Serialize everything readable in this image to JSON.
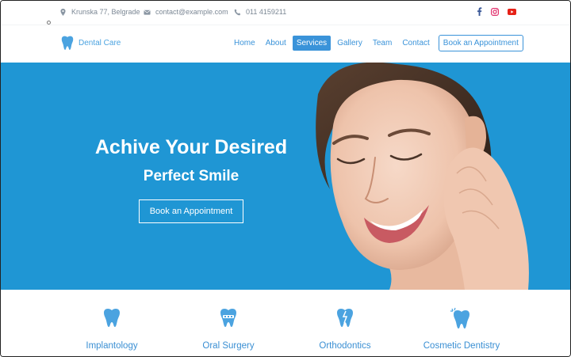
{
  "topbar": {
    "address": "Krunska 77, Belgrade",
    "email": "contact@example.com",
    "phone": "011 4159211",
    "social": [
      "facebook",
      "instagram",
      "youtube"
    ]
  },
  "header": {
    "brand": "Dental Care",
    "nav": [
      "Home",
      "About",
      "Services",
      "Gallery",
      "Team",
      "Contact"
    ],
    "active": "Services",
    "cta": "Book an Appointment"
  },
  "hero": {
    "title": "Achive Your Desired",
    "subtitle": "Perfect Smile",
    "button": "Book an Appointment",
    "background": "#1f96d4"
  },
  "services": {
    "items": [
      {
        "label": "Implantology",
        "icon": "tooth-implant-icon"
      },
      {
        "label": "Oral Surgery",
        "icon": "tooth-surgery-icon"
      },
      {
        "label": "Orthodontics",
        "icon": "tooth-braces-icon"
      },
      {
        "label": "Cosmetic Dentistry",
        "icon": "tooth-sparkle-icon"
      }
    ]
  },
  "colors": {
    "accent": "#3a93d9",
    "hero": "#1f96d4"
  }
}
